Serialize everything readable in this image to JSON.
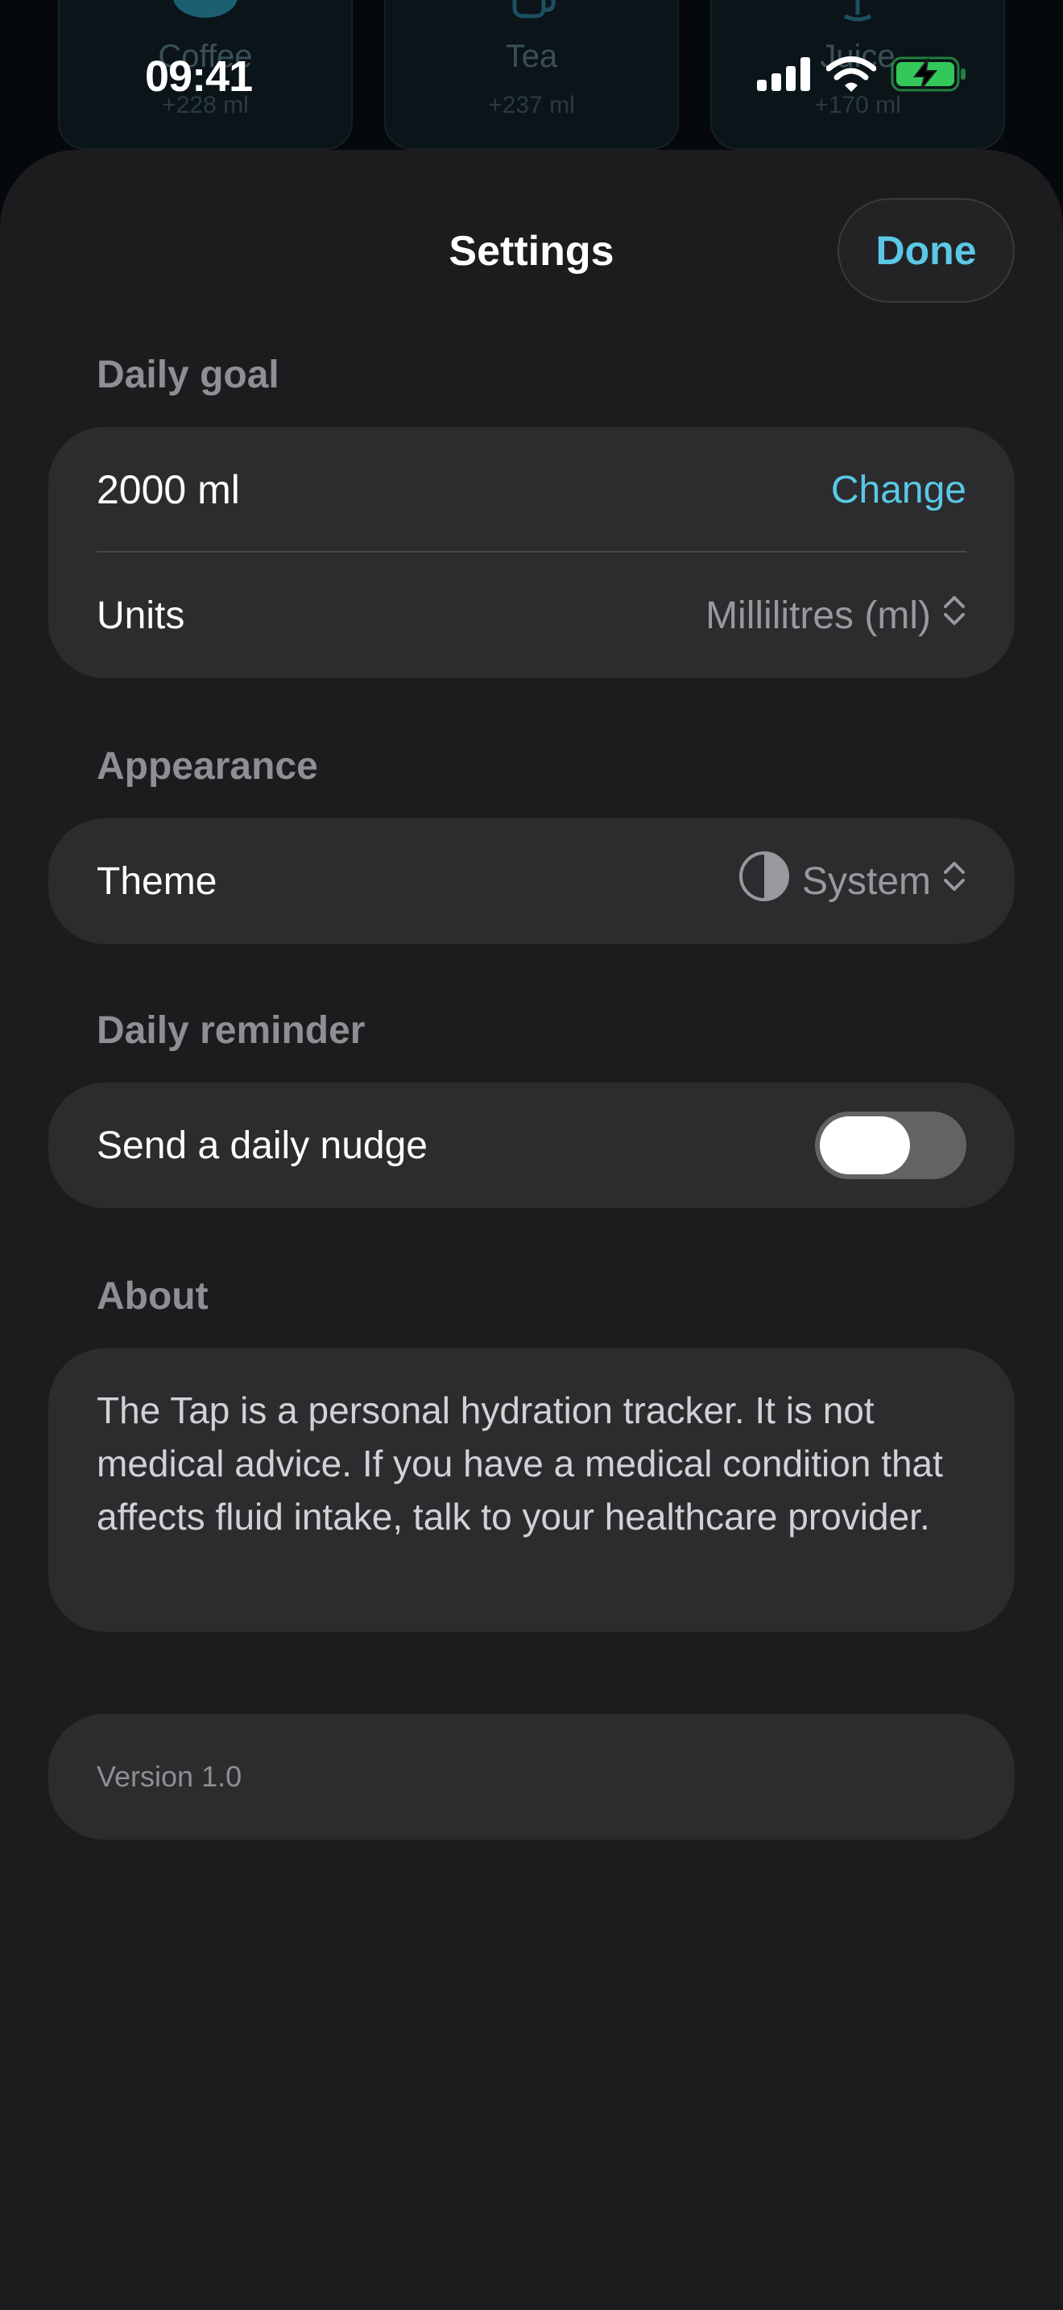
{
  "status_bar": {
    "time": "09:41"
  },
  "background_app": {
    "cards": [
      {
        "name": "Coffee",
        "amount": "+228 ml",
        "icon": "coffee-cup-icon"
      },
      {
        "name": "Tea",
        "amount": "+237 ml",
        "icon": "mug-icon"
      },
      {
        "name": "Juice",
        "amount": "+170 ml",
        "icon": "glass-icon"
      }
    ]
  },
  "sheet": {
    "title": "Settings",
    "done_label": "Done"
  },
  "daily_goal": {
    "header": "Daily goal",
    "value": "2000 ml",
    "change_label": "Change",
    "units_label": "Units",
    "units_value": "Millilitres (ml)"
  },
  "appearance": {
    "header": "Appearance",
    "theme_label": "Theme",
    "theme_value": "System"
  },
  "reminder": {
    "header": "Daily reminder",
    "toggle_label": "Send a daily nudge",
    "enabled": false
  },
  "about": {
    "header": "About",
    "text": "The Tap is a personal hydration tracker. It is not medical advice. If you have a medical condition that affects fluid intake, talk to your healthcare provider."
  },
  "version": {
    "text": "Version 1.0"
  },
  "colors": {
    "accent": "#5ac8e6",
    "sheet_background": "#1c1c1e",
    "group_background": "#2c2c2e",
    "battery_green": "#34c759"
  }
}
